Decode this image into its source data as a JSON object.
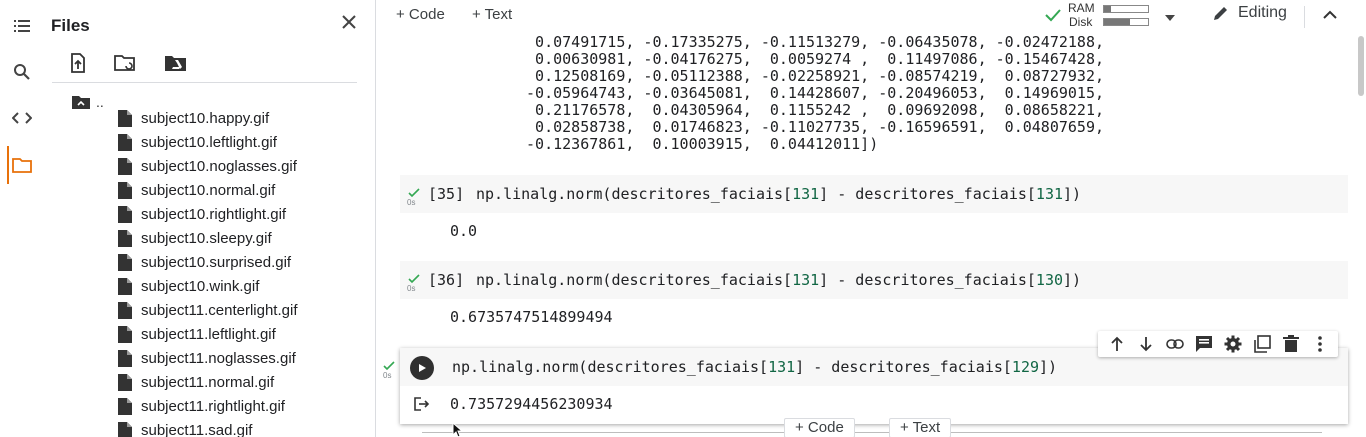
{
  "rail": {
    "items": [
      "table-of-contents",
      "search",
      "code-snippets",
      "files"
    ],
    "active": "files"
  },
  "files_panel": {
    "title": "Files",
    "parent_label": "..",
    "files": [
      "subject10.happy.gif",
      "subject10.leftlight.gif",
      "subject10.noglasses.gif",
      "subject10.normal.gif",
      "subject10.rightlight.gif",
      "subject10.sleepy.gif",
      "subject10.surprised.gif",
      "subject10.wink.gif",
      "subject11.centerlight.gif",
      "subject11.leftlight.gif",
      "subject11.noglasses.gif",
      "subject11.normal.gif",
      "subject11.rightlight.gif",
      "subject11.sad.gif"
    ]
  },
  "topbar": {
    "add_code": "+ Code",
    "add_text": "+ Text",
    "ram_label": "RAM",
    "disk_label": "Disk",
    "ram_fraction": 0.15,
    "disk_fraction": 0.6,
    "editing_label": "Editing"
  },
  "array_output": [
    "  0.07491715, -0.17335275, -0.11513279, -0.06435078, -0.02472188,",
    "  0.00630981, -0.04176275,  0.0059274 ,  0.11497086, -0.15467428,",
    "  0.12508169, -0.05112388, -0.02258921, -0.08574219,  0.08727932,",
    " -0.05964743, -0.03645081,  0.14428607, -0.20496053,  0.14969015,",
    "  0.21176578,  0.04305964,  0.1155242 ,  0.09692098,  0.08658221,",
    "  0.02858738,  0.01746823, -0.11027735, -0.16596591,  0.04807659,",
    " -0.12367861,  0.10003915,  0.04412011])"
  ],
  "cells": [
    {
      "prompt": "[35]",
      "time": "0s",
      "code_pre": "np.linalg.norm(descritores_faciais[",
      "idx1": "131",
      "code_mid": "] - descritores_faciais[",
      "idx2": "131",
      "code_post": "])",
      "output": "0.0"
    },
    {
      "prompt": "[36]",
      "time": "0s",
      "code_pre": "np.linalg.norm(descritores_faciais[",
      "idx1": "131",
      "code_mid": "] - descritores_faciais[",
      "idx2": "130",
      "code_post": "])",
      "output": "0.6735747514899494"
    },
    {
      "prompt": "",
      "time": "0s",
      "code_pre": "np.linalg.norm(descritores_faciais[",
      "idx1": "131",
      "code_mid": "] - descritores_faciais[",
      "idx2": "129",
      "code_post": "])",
      "output": "0.7357294456230934"
    }
  ],
  "cell_toolbar": [
    "move-up",
    "move-down",
    "link",
    "comment",
    "settings",
    "mirror-cell",
    "delete",
    "more"
  ],
  "bottom_add": {
    "code": "+ Code",
    "text": "+ Text"
  },
  "colors": {
    "accent_orange": "#e8710a",
    "number_green": "#116644",
    "check_green": "#34a853"
  }
}
